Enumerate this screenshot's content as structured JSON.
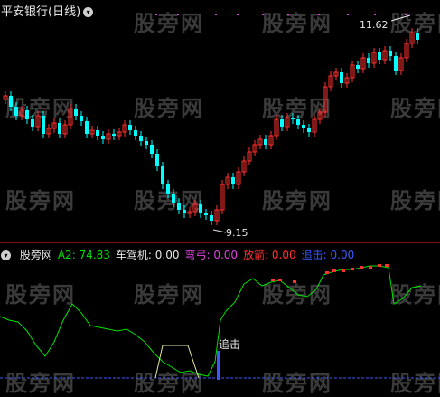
{
  "price_panel": {
    "title": "平安银行(日线)",
    "high_label": "11.62",
    "low_label": "9.15"
  },
  "indicator_panel": {
    "name": "股旁网",
    "items": [
      {
        "label": "A2: 74.83",
        "color": "#00e000"
      },
      {
        "label": "车驾机: 0.00",
        "color": "#e8e8e8"
      },
      {
        "label": "弯弓: 0.00",
        "color": "#e040e0"
      },
      {
        "label": "放箭: 0.00",
        "color": "#ff3030"
      },
      {
        "label": "追击: 0.00",
        "color": "#3a5aff"
      }
    ],
    "annotation": "追击"
  },
  "watermark": "股旁网",
  "colors": {
    "up": "#ff3030",
    "down": "#00ffff",
    "line": "#00e000",
    "bg": "#000000"
  }
}
